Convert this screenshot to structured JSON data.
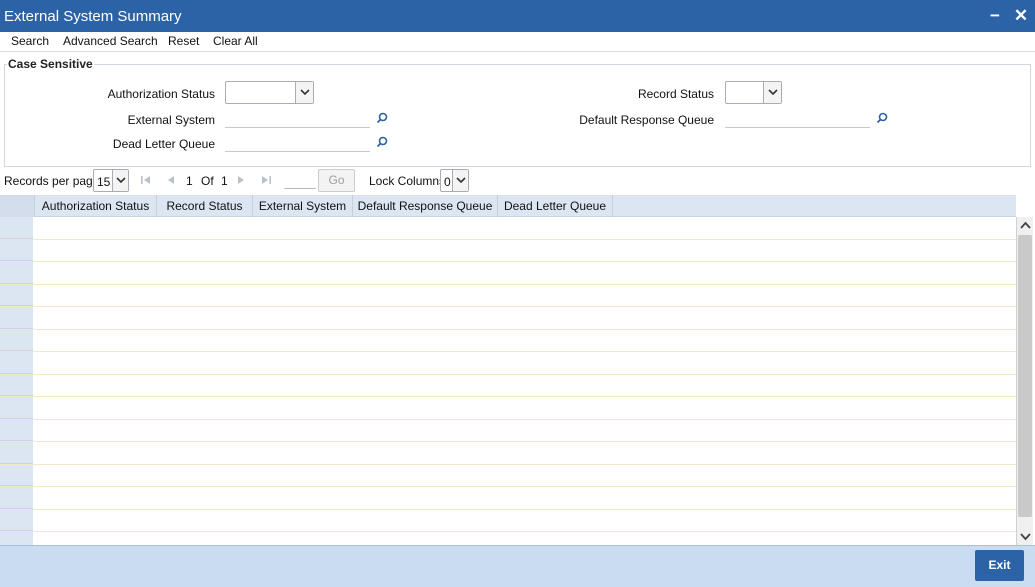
{
  "window": {
    "title": "External System Summary",
    "minimize_glyph": "−",
    "close_glyph": "✕"
  },
  "toolbar": {
    "items": [
      "Search",
      "Advanced Search",
      "Reset",
      "Clear All"
    ]
  },
  "criteria": {
    "legend": "Case Sensitive",
    "authorization_status_label": "Authorization Status",
    "authorization_status_value": "",
    "record_status_label": "Record Status",
    "record_status_value": "",
    "external_system_label": "External System",
    "external_system_value": "",
    "default_response_queue_label": "Default Response Queue",
    "default_response_queue_value": "",
    "dead_letter_queue_label": "Dead Letter Queue",
    "dead_letter_queue_value": ""
  },
  "pager": {
    "records_per_page_label": "Records per page",
    "records_per_page_value": "15",
    "current_page": "1",
    "of_label": "Of",
    "total_pages": "1",
    "go_label": "Go",
    "lock_columns_label": "Lock Columns",
    "lock_columns_value": "0"
  },
  "grid": {
    "columns": [
      "Authorization Status",
      "Record Status",
      "External System",
      "Default Response Queue",
      "Dead Letter Queue"
    ],
    "row_count": 15
  },
  "footer": {
    "exit_label": "Exit"
  },
  "colors": {
    "title_bar": "#2c62a6",
    "header_bg": "#dce6f3",
    "footer_bg": "#c9dcf2"
  }
}
